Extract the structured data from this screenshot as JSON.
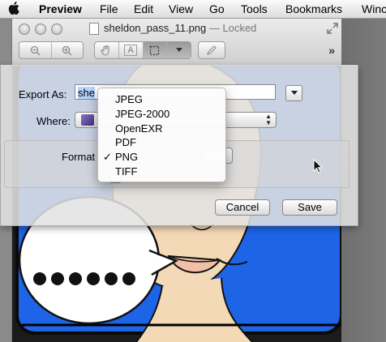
{
  "menubar": {
    "app_name": "Preview",
    "items": [
      "File",
      "Edit",
      "View",
      "Go",
      "Tools",
      "Bookmarks",
      "Winc"
    ]
  },
  "window": {
    "title": "sheldon_pass_11.png",
    "status": " — Locked",
    "toolbar": {
      "overflow": "»",
      "zoom_out": "−",
      "zoom_in": "+",
      "text_tool": "A"
    }
  },
  "export_sheet": {
    "export_as_label": "Export As:",
    "filename_selected": "sheldon_pass_",
    "filename_visible": "she",
    "where_label": "Where:",
    "format_label": "Format",
    "cancel_label": "Cancel",
    "save_label": "Save"
  },
  "format_menu": {
    "options": [
      "JPEG",
      "JPEG-2000",
      "OpenEXR",
      "PDF",
      "PNG",
      "TIFF"
    ],
    "selected": "PNG",
    "checkmark": "✓"
  },
  "picture": {
    "bubble_text": "●●●●●●"
  },
  "colors": {
    "image_background": "#1e64e6",
    "skin": "#f4d9b6"
  },
  "icons": [
    "apple-icon",
    "document-icon",
    "fullscreen-icon",
    "zoom-out-icon",
    "zoom-in-icon",
    "hand-icon",
    "text-icon",
    "select-icon",
    "annotate-icon",
    "folder-icon",
    "cursor-icon"
  ]
}
